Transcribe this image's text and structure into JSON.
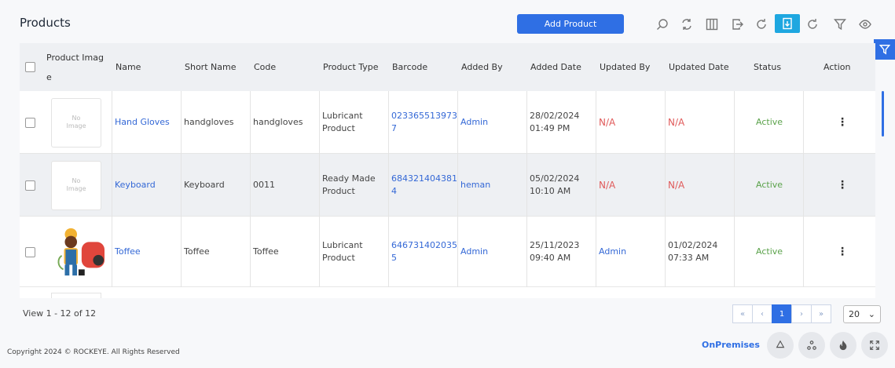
{
  "header": {
    "title": "Products",
    "add_label": "Add Product"
  },
  "toolbar": [
    "search-icon",
    "refresh-icon",
    "columns-icon",
    "export-icon",
    "reload-icon",
    "download-icon",
    "sync-icon",
    "filter-icon",
    "eye-icon"
  ],
  "columns": [
    "Product Imag",
    "e",
    "Name",
    "Short Name",
    "Code",
    "Product Type",
    "Barcode",
    "Added By",
    "Added Date",
    "Updated By",
    "Updated Date",
    "Status",
    "Action"
  ],
  "rows": [
    {
      "image": "No Image",
      "name": "Hand Gloves",
      "short": "handgloves",
      "code": "handgloves",
      "type1": "Lubricant",
      "type2": "Product",
      "bar1": "023365513973",
      "bar2": "7",
      "added_by": "Admin",
      "added_date1": "28/02/2024",
      "added_date2": "01:49 PM",
      "updated_by": "N/A",
      "updated_date1": "N/A",
      "updated_date2": "",
      "status": "Active"
    },
    {
      "image": "No Image",
      "name": "Keyboard",
      "short": "Keyboard",
      "code": "0011",
      "type1": "Ready Made",
      "type2": "Product",
      "bar1": "684321404381",
      "bar2": "4",
      "added_by": "heman",
      "added_date1": "05/02/2024",
      "added_date2": "10:10 AM",
      "updated_by": "N/A",
      "updated_date1": "N/A",
      "updated_date2": "",
      "status": "Active"
    },
    {
      "image": "",
      "name": "Toffee",
      "short": "Toffee",
      "code": "Toffee",
      "type1": "Lubricant",
      "type2": "Product",
      "bar1": "646731402035",
      "bar2": "5",
      "added_by": "Admin",
      "added_date1": "25/11/2023",
      "added_date2": "09:40 AM",
      "updated_by": "Admin",
      "updated_date1": "01/02/2024",
      "updated_date2": "07:33 AM",
      "status": "Active"
    }
  ],
  "image_text": {
    "l1": "No",
    "l2": "Image"
  },
  "footer": {
    "view": "View 1 - 12 of 12",
    "pager": [
      "«",
      "‹",
      "1",
      "›",
      "»"
    ],
    "page_size": "20",
    "copyright": "Copyright 2024 © ROCKEYE. All Rights Reserved",
    "onprem": "OnPremises"
  },
  "colors": {
    "accent": "#2f6fe4",
    "active": "#5aa24a",
    "na": "#e05a5a"
  }
}
